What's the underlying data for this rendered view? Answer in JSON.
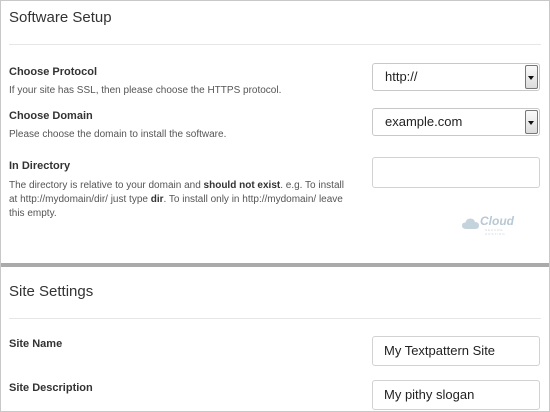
{
  "software_setup": {
    "title": "Software Setup",
    "protocol": {
      "label": "Choose Protocol",
      "description": "If your site has SSL, then please choose the HTTPS protocol.",
      "selected": "http://"
    },
    "domain": {
      "label": "Choose Domain",
      "description": "Please choose the domain to install the software.",
      "selected": "example.com"
    },
    "directory": {
      "label": "In Directory",
      "desc_part1": "The directory is relative to your domain and ",
      "desc_bold1": "should not exist",
      "desc_part2": ". e.g. To install at http://mydomain/dir/ just type ",
      "desc_bold2": "dir",
      "desc_part3": ". To install only in http://mydomain/ leave this empty.",
      "value": ""
    }
  },
  "watermark": {
    "text": "Cloud",
    "subtext": "SECURE HOSTING"
  },
  "site_settings": {
    "title": "Site Settings",
    "site_name": {
      "label": "Site Name",
      "value": "My Textpattern Site"
    },
    "site_description": {
      "label": "Site Description",
      "value": "My pithy slogan"
    }
  }
}
